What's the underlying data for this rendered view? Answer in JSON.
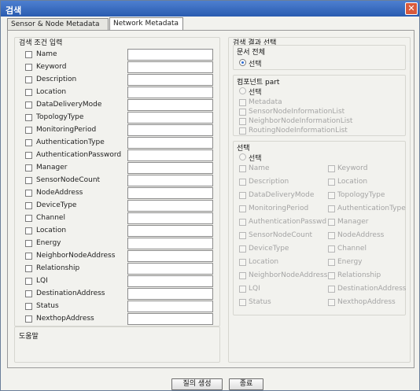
{
  "window": {
    "title": "검색",
    "close_icon": "✕"
  },
  "tabs": [
    {
      "label": "Sensor & Node Metadata"
    },
    {
      "label": "Network Metadata"
    }
  ],
  "left": {
    "group_title": "검색 조건 입력",
    "rows": [
      "Name",
      "Keyword",
      "Description",
      "Location",
      "DataDeliveryMode",
      "TopologyType",
      "MonitoringPeriod",
      "AuthenticationType",
      "AuthenticationPassword",
      "Manager",
      "SensorNodeCount",
      "NodeAddress",
      "DeviceType",
      "Channel",
      "Location",
      "Energy",
      "NeighborNodeAddress",
      "Relationship",
      "LQI",
      "DestinationAddress",
      "Status",
      "NexthopAddress"
    ],
    "help_title": "도움말"
  },
  "right": {
    "group_title": "검색 결과 선택",
    "doc_section": {
      "title": "문서 전체",
      "radio_label": "선택"
    },
    "component_section": {
      "title": "컴포넌트 part",
      "radio_label": "선택",
      "items": [
        "Metadata",
        "SensorNodeInformationList",
        "NeighborNodeInformationList",
        "RoutingNodeInformationList"
      ]
    },
    "select_section": {
      "title": "선택",
      "radio_label": "선택",
      "col1": [
        "Name",
        "Description",
        "DataDeliveryMode",
        "MonitoringPeriod",
        "AuthenticationPasswd",
        "SensorNodeCount",
        "DeviceType",
        "Location",
        "NeighborNodeAddress",
        "LQI",
        "Status"
      ],
      "col2": [
        "Keyword",
        "Location",
        "TopologyType",
        "AuthenticationType",
        "Manager",
        "NodeAddress",
        "Channel",
        "Energy",
        "Relationship",
        "DestinationAddress",
        "NexthopAddress"
      ]
    }
  },
  "footer": {
    "generate_label": "질의 생성",
    "close_label": "종료"
  }
}
